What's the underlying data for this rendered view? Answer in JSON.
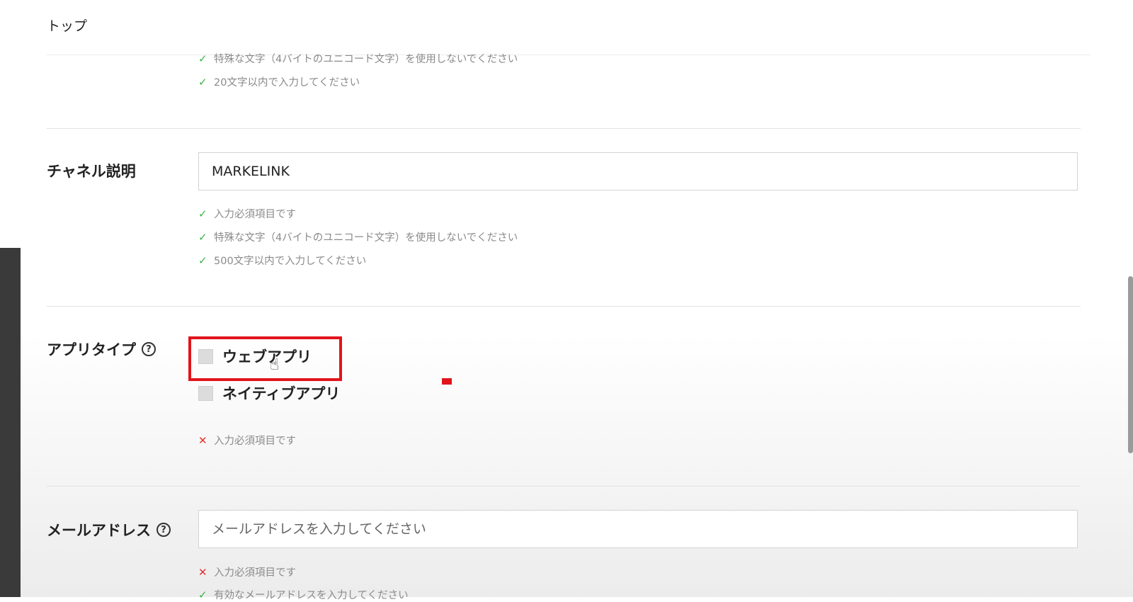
{
  "breadcrumb": "トップ",
  "channel_name_rules": [
    {
      "mark": "✓",
      "text": "特殊な文字（4バイトのユニコード文字）を使用しないでください"
    },
    {
      "mark": "✓",
      "text": "20文字以内で入力してください"
    }
  ],
  "channel_description": {
    "label": "チャネル説明",
    "value": "MARKELINK",
    "rules": [
      {
        "mark": "✓",
        "text": "入力必須項目です"
      },
      {
        "mark": "✓",
        "text": "特殊な文字（4バイトのユニコード文字）を使用しないでください"
      },
      {
        "mark": "✓",
        "text": "500文字以内で入力してください"
      }
    ]
  },
  "app_type": {
    "label": "アプリタイプ",
    "help_icon": "?",
    "options": [
      {
        "label": "ウェブアプリ",
        "checked": false
      },
      {
        "label": "ネイティブアプリ",
        "checked": false
      }
    ],
    "rules": [
      {
        "mark": "✕",
        "text": "入力必須項目です"
      }
    ]
  },
  "email": {
    "label": "メールアドレス",
    "help_icon": "?",
    "placeholder": "メールアドレスを入力してください",
    "rules": [
      {
        "mark": "✕",
        "text": "入力必須項目です"
      },
      {
        "mark": "✓",
        "text": "有効なメールアドレスを入力してください"
      }
    ]
  },
  "colors": {
    "ok": "#3cb34a",
    "error": "#e03131",
    "highlight": "#e1141c"
  }
}
